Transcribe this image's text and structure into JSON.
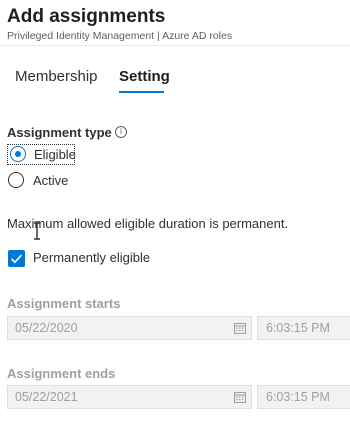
{
  "header": {
    "title": "Add assignments",
    "subtitle": "Privileged Identity Management | Azure AD roles"
  },
  "tabs": [
    {
      "label": "Membership",
      "selected": false
    },
    {
      "label": "Setting",
      "selected": true
    }
  ],
  "assignment_type": {
    "label": "Assignment type",
    "info_icon": "info-icon",
    "options": [
      {
        "label": "Eligible",
        "selected": true
      },
      {
        "label": "Active",
        "selected": false
      }
    ]
  },
  "duration_info": "Maximum allowed eligible duration is permanent.",
  "permanently_eligible": {
    "label": "Permanently eligible",
    "checked": true
  },
  "assignment_starts": {
    "label": "Assignment starts",
    "date": "05/22/2020",
    "time": "6:03:15 PM",
    "disabled": true
  },
  "assignment_ends": {
    "label": "Assignment ends",
    "date": "05/22/2021",
    "time": "6:03:15 PM",
    "disabled": true
  },
  "colors": {
    "accent": "#0078d4",
    "text": "#323130",
    "disabled_text": "#a19f9d",
    "disabled_bg": "#f3f2f1"
  }
}
